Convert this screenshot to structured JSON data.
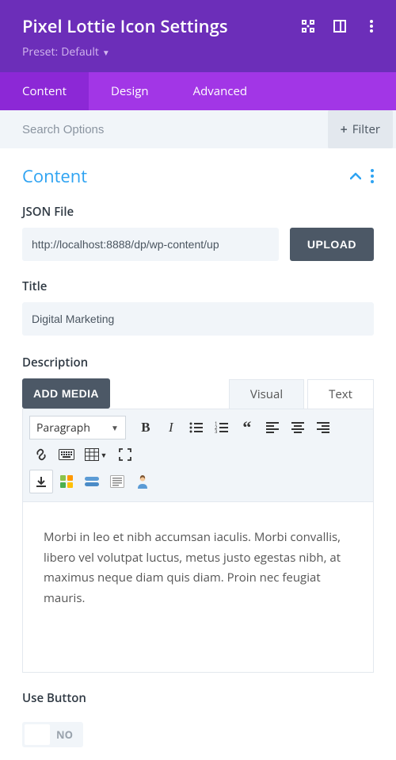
{
  "header": {
    "title": "Pixel Lottie Icon Settings",
    "preset_label": "Preset:",
    "preset_value": "Default"
  },
  "tabs": {
    "content": "Content",
    "design": "Design",
    "advanced": "Advanced"
  },
  "search": {
    "placeholder": "Search Options",
    "filter_label": "Filter"
  },
  "section": {
    "title": "Content"
  },
  "fields": {
    "json_label": "JSON File",
    "json_value": "http://localhost:8888/dp/wp-content/up",
    "upload_label": "UPLOAD",
    "title_label": "Title",
    "title_value": "Digital Marketing",
    "description_label": "Description",
    "add_media_label": "ADD MEDIA",
    "use_button_label": "Use Button",
    "use_button_state": "NO"
  },
  "editor": {
    "tab_visual": "Visual",
    "tab_text": "Text",
    "format_selected": "Paragraph",
    "body": "Morbi in leo et nibh accumsan iaculis. Morbi convallis, libero vel volutpat luctus, metus justo egestas nibh, at maximus neque diam quis diam. Proin nec feugiat mauris."
  }
}
